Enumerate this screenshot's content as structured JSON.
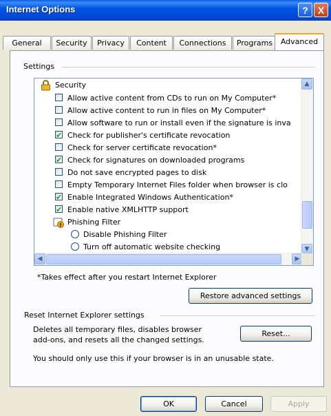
{
  "window": {
    "title": "Internet Options",
    "help_glyph": "?",
    "close_glyph": "X"
  },
  "tabs": [
    {
      "label": "General"
    },
    {
      "label": "Security"
    },
    {
      "label": "Privacy"
    },
    {
      "label": "Content"
    },
    {
      "label": "Connections"
    },
    {
      "label": "Programs"
    },
    {
      "label": "Advanced",
      "active": true
    }
  ],
  "settings": {
    "group_label": "Settings",
    "category": "Security",
    "items": [
      {
        "type": "checkbox",
        "checked": false,
        "label": "Allow active content from CDs to run on My Computer*"
      },
      {
        "type": "checkbox",
        "checked": false,
        "label": "Allow active content to run in files on My Computer*"
      },
      {
        "type": "checkbox",
        "checked": false,
        "label": "Allow software to run or install even if the signature is inva"
      },
      {
        "type": "checkbox",
        "checked": true,
        "label": "Check for publisher's certificate revocation"
      },
      {
        "type": "checkbox",
        "checked": false,
        "label": "Check for server certificate revocation*"
      },
      {
        "type": "checkbox",
        "checked": true,
        "label": "Check for signatures on downloaded programs"
      },
      {
        "type": "checkbox",
        "checked": false,
        "label": "Do not save encrypted pages to disk"
      },
      {
        "type": "checkbox",
        "checked": false,
        "label": "Empty Temporary Internet Files folder when browser is clo"
      },
      {
        "type": "checkbox",
        "checked": true,
        "label": "Enable Integrated Windows Authentication*"
      },
      {
        "type": "checkbox",
        "checked": true,
        "label": "Enable native XMLHTTP support"
      },
      {
        "type": "folder",
        "label": "Phishing Filter"
      },
      {
        "type": "radio",
        "checked": false,
        "label": "Disable Phishing Filter"
      },
      {
        "type": "radio",
        "checked": false,
        "label": "Turn off automatic website checking"
      }
    ],
    "note": "*Takes effect after you restart Internet Explorer",
    "restore_button": "Restore advanced settings"
  },
  "reset": {
    "group_label": "Reset Internet Explorer settings",
    "desc_line1": "Deletes all temporary files, disables browser",
    "desc_line2": "add-ons, and resets all the changed settings.",
    "button": "Reset...",
    "warning": "You should only use this if your browser is in an unusable state."
  },
  "footer": {
    "ok": "OK",
    "cancel": "Cancel",
    "apply": "Apply"
  },
  "colors": {
    "titlebar": "#0055e5",
    "face": "#ece9d8",
    "tab_highlight": "#f5a623",
    "check": "#21a121"
  }
}
